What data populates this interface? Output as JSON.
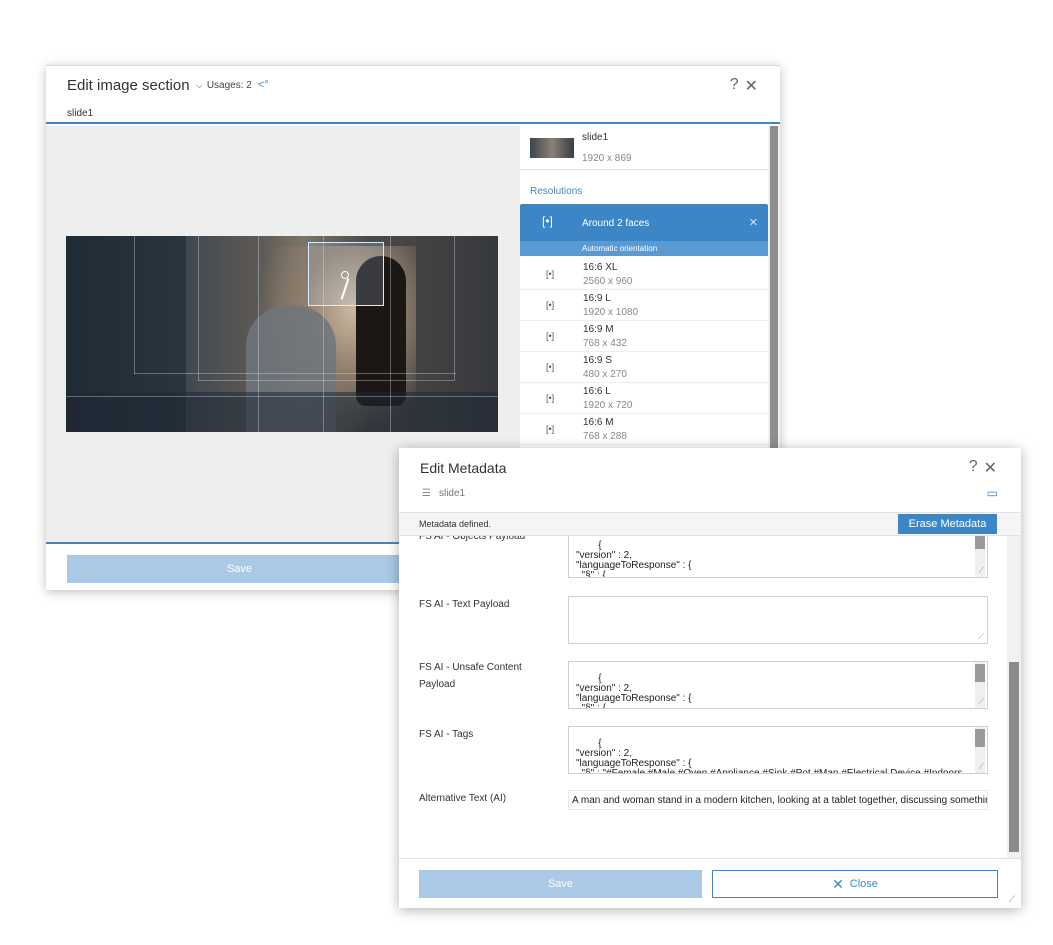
{
  "image_dialog": {
    "title": "Edit image section",
    "usages_label": "Usages: 2",
    "subtitle": "slide1",
    "help_label": "?",
    "close_label": "✕",
    "save_label": "Save",
    "slide": {
      "name": "slide1",
      "dimensions": "1920 x 869"
    },
    "resolutions_heading": "Resolutions",
    "selected": {
      "label": "Around 2 faces",
      "orientation": "Automatic orientation"
    },
    "resolutions": [
      {
        "name": "16:6 XL",
        "dimensions": "2560 x 960"
      },
      {
        "name": "16:9 L",
        "dimensions": "1920 x 1080"
      },
      {
        "name": "16:9 M",
        "dimensions": "768 x 432"
      },
      {
        "name": "16:9 S",
        "dimensions": "480 x 270"
      },
      {
        "name": "16:6 L",
        "dimensions": "1920 x 720"
      },
      {
        "name": "16:6 M",
        "dimensions": "768 x 288"
      }
    ]
  },
  "metadata_dialog": {
    "title": "Edit Metadata",
    "help_label": "?",
    "close_label": "✕",
    "doc_name": "slide1",
    "status_text": "Metadata defined.",
    "erase_label": "Erase Metadata",
    "fields": [
      {
        "label": "FS AI - Objects Payload",
        "value": "{\n\"version\" : 2,\n\"languageToResponse\" : {\n  \"§\" : {"
      },
      {
        "label": "FS AI - Text Payload",
        "value": ""
      },
      {
        "label": "FS AI - Unsafe Content Payload",
        "value": "{\n\"version\" : 2,\n\"languageToResponse\" : {\n  \"§\" : {"
      },
      {
        "label": "FS AI - Tags",
        "value": "{\n\"version\" : 2,\n\"languageToResponse\" : {\n  \"§\" : \"#Female #Male #Oven #Appliance #Sink #Pot #Man #Electrical Device #Indoors"
      }
    ],
    "alt_text_label": "Alternative Text (AI)",
    "alt_text_value": "A man and woman stand in a modern kitchen, looking at a tablet together, discussing somethir",
    "save_label": "Save",
    "close_button_label": "Close"
  },
  "colors": {
    "accent": "#3d86c6",
    "disabled_button": "#a9c9e6"
  }
}
